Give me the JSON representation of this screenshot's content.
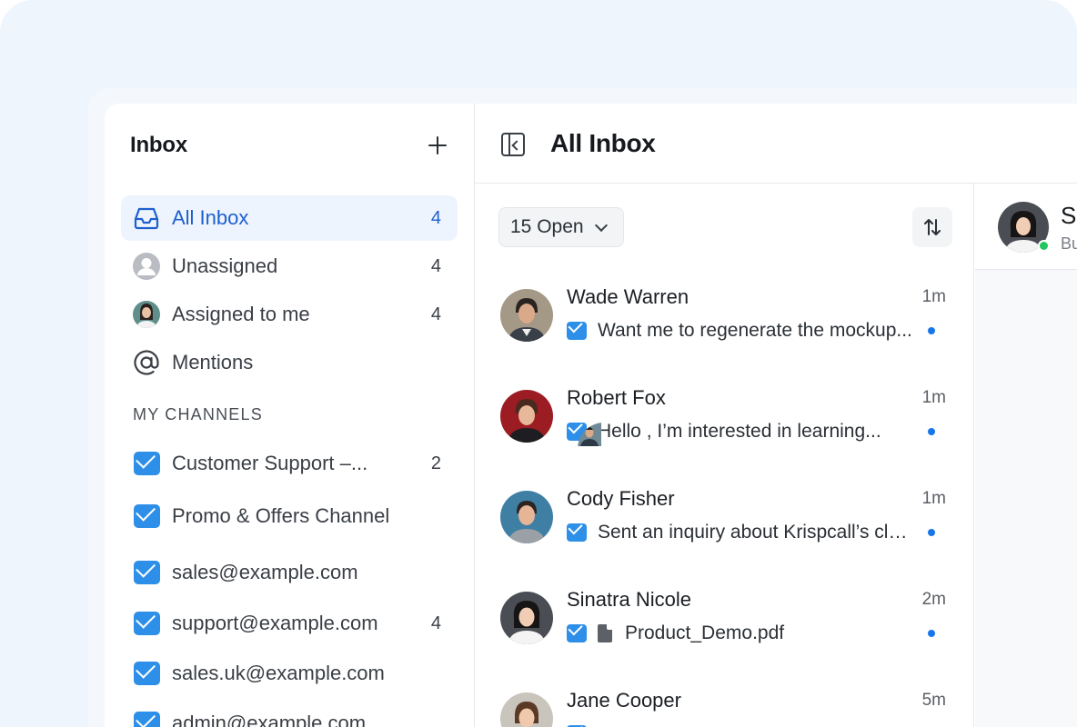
{
  "sidebar": {
    "title": "Inbox",
    "items": [
      {
        "label": "All Inbox",
        "count": "4"
      },
      {
        "label": "Unassigned",
        "count": "4"
      },
      {
        "label": "Assigned to me",
        "count": "4"
      },
      {
        "label": "Mentions",
        "count": ""
      }
    ],
    "section_label": "MY CHANNELS",
    "channels": [
      {
        "label": "Customer Support –...",
        "count": "2"
      },
      {
        "label": "Promo & Offers Channel",
        "count": ""
      },
      {
        "label": "sales@example.com",
        "count": ""
      },
      {
        "label": "support@example.com",
        "count": "4"
      },
      {
        "label": "sales.uk@example.com",
        "count": ""
      },
      {
        "label": "admin@example.com",
        "count": ""
      }
    ]
  },
  "main": {
    "title": "All Inbox",
    "filter_label": "15 Open"
  },
  "conversations": [
    {
      "name": "Wade Warren",
      "time": "1m",
      "preview": "Want me to regenerate the mockup..."
    },
    {
      "name": "Robert Fox",
      "time": "1m",
      "preview": "Hello , I’m interested in learning..."
    },
    {
      "name": "Cody Fisher",
      "time": "1m",
      "preview": "Sent an inquiry about Krispcall’s clo..."
    },
    {
      "name": "Sinatra Nicole",
      "time": "2m",
      "preview": "Product_Demo.pdf"
    },
    {
      "name": "Jane Cooper",
      "time": "5m",
      "preview": ""
    }
  ],
  "detail": {
    "name": "Si",
    "subtitle": "Bu"
  },
  "colors": {
    "accent": "#1d5fcf",
    "active_bg": "#eef4fd",
    "mail_icon": "#2d8fe8",
    "unread_dot": "#1877e8",
    "online": "#22c55e"
  }
}
